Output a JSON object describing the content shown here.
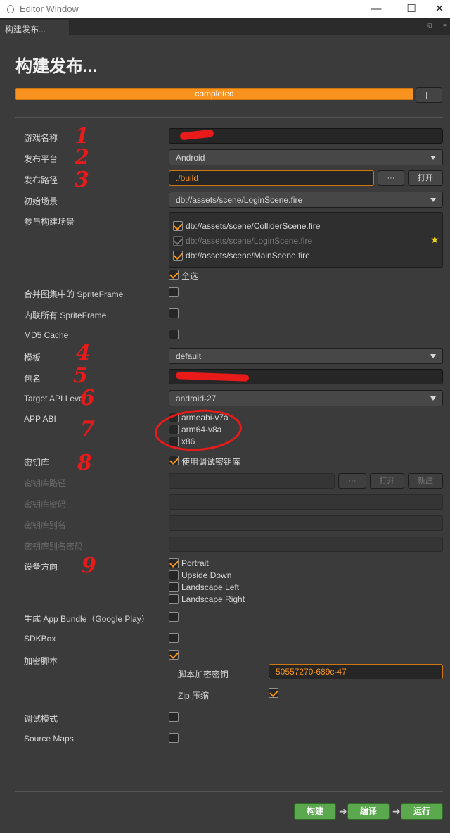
{
  "window": {
    "title": "Editor Window",
    "minimize": "—",
    "maximize": "☐",
    "close": "✕"
  },
  "tab": {
    "label": "构建发布...",
    "icons": [
      "⧉",
      "≡"
    ]
  },
  "page_title": "构建发布...",
  "progress": {
    "label": "completed",
    "value": 1.0
  },
  "labels": {
    "game_name": "游戏名称",
    "platform": "发布平台",
    "build_path": "发布路径",
    "start_scene": "初始场景",
    "scenes": "参与构建场景",
    "merge_sf": "合并图集中的 SpriteFrame",
    "inline_sf": "内联所有 SpriteFrame",
    "md5": "MD5 Cache",
    "template": "模板",
    "package": "包名",
    "api_level": "Target API Level",
    "app_abi": "APP ABI",
    "keystore": "密钥库",
    "keystore_path": "密钥库路径",
    "keystore_password": "密钥库密码",
    "keystore_alias": "密钥库别名",
    "keystore_alias_password": "密钥库别名密码",
    "orientation": "设备方向",
    "app_bundle": "生成 App Bundle（Google Play）",
    "sdkbox": "SDKBox",
    "encrypt": "加密脚本",
    "encrypt_key": "脚本加密密钥",
    "zip": "Zip 压缩",
    "debug": "调试模式",
    "source_maps": "Source Maps"
  },
  "values": {
    "platform": "Android",
    "build_path": "./build",
    "start_scene": "db://assets/scene/LoginScene.fire",
    "template": "default",
    "api_level": "android-27",
    "encrypt_key": "50557270-689c-47"
  },
  "buttons": {
    "path_more": "···",
    "path_open": "打开",
    "ks_more": "···",
    "ks_open": "打开",
    "ks_new": "新建"
  },
  "scenes": [
    {
      "path": "db://assets/scene/ColliderScene.fire",
      "checked": true,
      "disabled": false
    },
    {
      "path": "db://assets/scene/LoginScene.fire",
      "checked": true,
      "disabled": true
    },
    {
      "path": "db://assets/scene/MainScene.fire",
      "checked": true,
      "disabled": false
    }
  ],
  "select_all": "全选",
  "abi": [
    "armeabi-v7a",
    "arm64-v8a",
    "x86"
  ],
  "use_debug_keystore": "使用调试密钥库",
  "orientations": [
    "Portrait",
    "Upside Down",
    "Landscape Left",
    "Landscape Right"
  ],
  "footer": {
    "build": "构建",
    "compile": "编译",
    "run": "运行"
  },
  "annotations": [
    "1",
    "2",
    "3",
    "4",
    "5",
    "6",
    "7",
    "8",
    "9"
  ],
  "colors": {
    "accent": "#f7931e",
    "go": "#5ca84e",
    "annotation": "#e81a1a"
  }
}
